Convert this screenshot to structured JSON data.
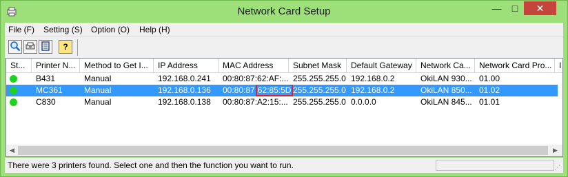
{
  "window": {
    "title": "Network Card Setup",
    "minimize": "—",
    "maximize": "□",
    "close": "✕"
  },
  "menu": [
    "File (F)",
    "Setting (S)",
    "Option (O)",
    "Help (H)"
  ],
  "toolbar": [
    {
      "icon": "search-icon"
    },
    {
      "icon": "settings-icon"
    },
    {
      "icon": "document-icon"
    },
    {
      "icon": "help-icon",
      "glyph": "?"
    }
  ],
  "table": {
    "columns": [
      "St...",
      "Printer N...",
      "Method to Get I...",
      "IP Address",
      "MAC Address",
      "Subnet Mask",
      "Default Gateway",
      "Network Ca...",
      "Network Card Pro...",
      "I"
    ],
    "rows": [
      {
        "status": "green",
        "printer": "B431",
        "method": "Manual",
        "ip": "192.168.0.241",
        "mac": "00:80:87:62:AF:...",
        "subnet": "255.255.255.0",
        "gateway": "192.168.0.2",
        "card": "OkiLAN 930...",
        "prog": "01.00",
        "selected": false
      },
      {
        "status": "green",
        "printer": "MC361",
        "method": "Manual",
        "ip": "192.168.0.136",
        "mac_prefix": "00:80:87",
        "mac_highlight": "62:85:5D",
        "subnet": "255.255.255.0",
        "gateway": "192.168.0.2",
        "card": "OkiLAN 850...",
        "prog": "01.02",
        "selected": true
      },
      {
        "status": "green",
        "printer": "C830",
        "method": "Manual",
        "ip": "192.168.0.138",
        "mac": "00:80:87:A2:15:...",
        "subnet": "255.255.255.0",
        "gateway": "0.0.0.0",
        "card": "OkiLAN 845...",
        "prog": "01.01",
        "selected": false
      }
    ]
  },
  "scroll": {
    "left": "◀",
    "right": "▶"
  },
  "status": {
    "text": "There were 3 printers found. Select one and then the function you want to run."
  },
  "colors": {
    "titlebar": "#9de07a",
    "selection": "#3399ff",
    "status_dot": "#1fd21f",
    "highlight_border": "#e0202a"
  }
}
